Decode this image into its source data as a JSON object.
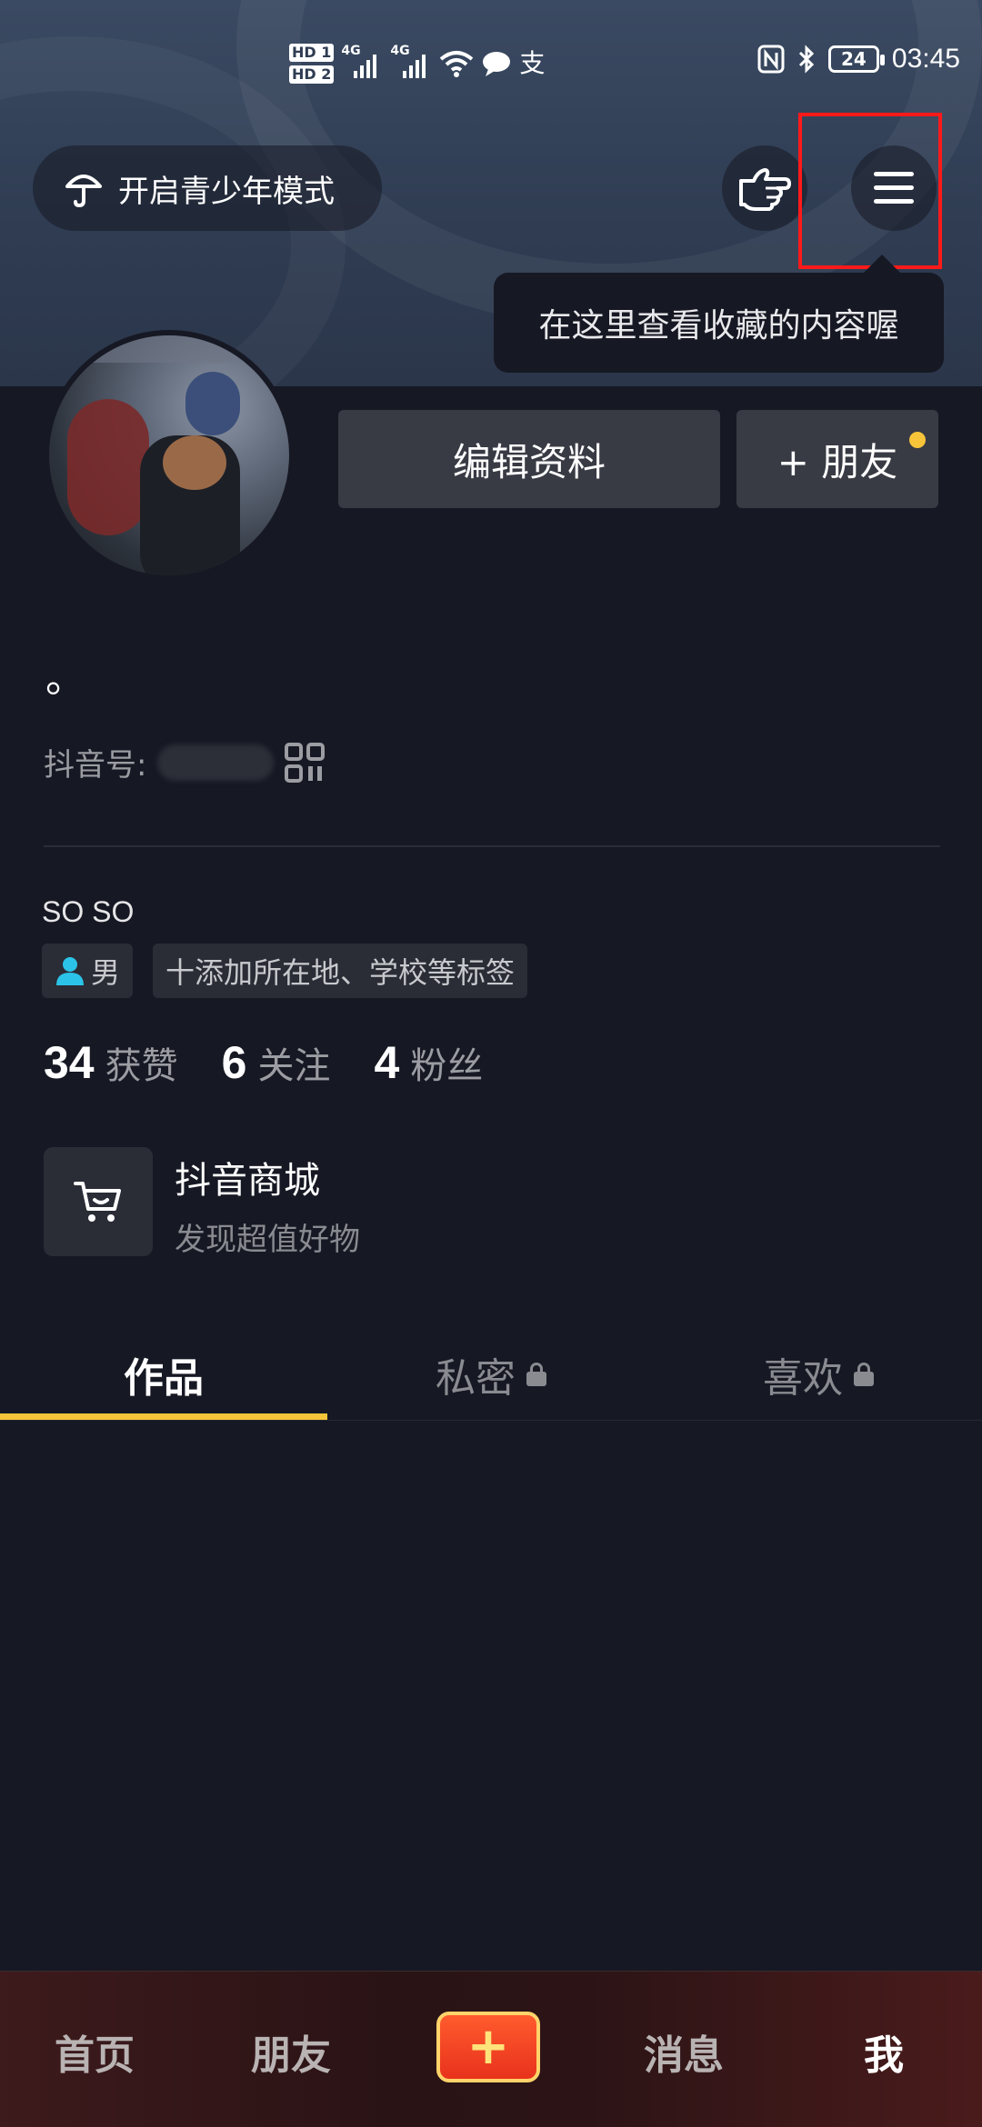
{
  "status_bar": {
    "hd1": "HD 1",
    "hd2": "HD 2",
    "net1": "4G",
    "net2": "4G",
    "battery": "24",
    "time": "03:45"
  },
  "header": {
    "teen_mode_label": "开启青少年模式",
    "tooltip": "在这里查看收藏的内容喔"
  },
  "profile": {
    "edit_button": "编辑资料",
    "add_friend_button": "+ 朋友",
    "nickname": "。",
    "douyin_id_label": "抖音号:",
    "bio": "SO SO",
    "gender_tag": "男",
    "add_tag": "十添加所在地、学校等标签"
  },
  "stats": [
    {
      "number": "34",
      "label": "获赞"
    },
    {
      "number": "6",
      "label": "关注"
    },
    {
      "number": "4",
      "label": "粉丝"
    }
  ],
  "shop": {
    "title": "抖音商城",
    "subtitle": "发现超值好物"
  },
  "tabs": [
    {
      "label": "作品"
    },
    {
      "label": "私密"
    },
    {
      "label": "喜欢"
    }
  ],
  "bottom_nav": {
    "home": "首页",
    "friends": "朋友",
    "create": "+",
    "messages": "消息",
    "me": "我"
  },
  "colors": {
    "background": "#161823",
    "accent": "#f8c53a",
    "highlight": "#ff1a1a"
  }
}
